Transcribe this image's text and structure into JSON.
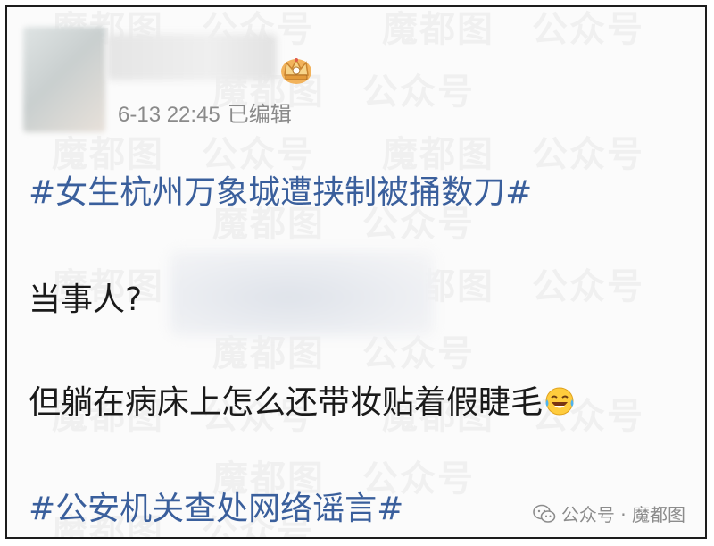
{
  "post": {
    "timestamp": "6-13 22:45",
    "edited_label": "已编辑",
    "hashtag_top": "#女生杭州万象城遭挟制被捅数刀#",
    "line_who": "当事人?",
    "line_makeup": "但躺在病床上怎么还带妆贴着假睫毛",
    "hashtag_bottom": "#公安机关查处网络谣言#"
  },
  "icons": {
    "badge": "crown-icon",
    "emoji": "laughing-tears-emoji-icon",
    "footer": "wechat-icon"
  },
  "watermark": {
    "text": "魔都图",
    "text2": "公众号",
    "footer_text": "公众号 · 魔都图"
  },
  "colors": {
    "hashtag": "#3a5f9c",
    "text": "#1a1a1a",
    "meta": "#8a8a8a",
    "border": "#1c1c1c"
  }
}
